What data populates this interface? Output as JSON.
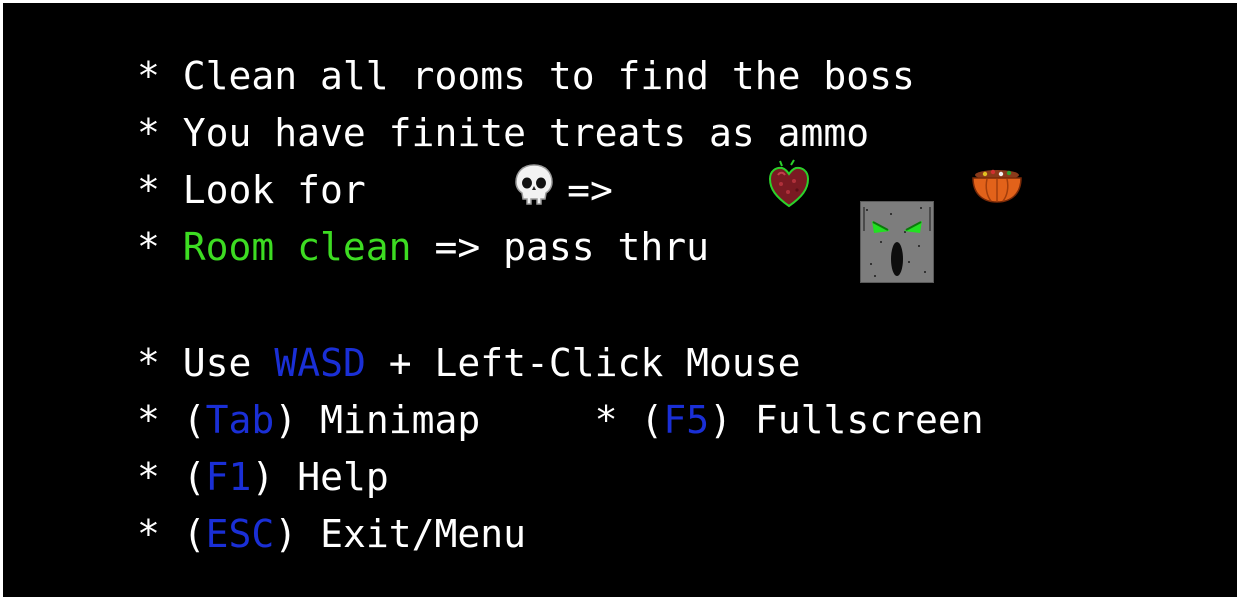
{
  "help": {
    "bullet": "*",
    "line1": "Clean all rooms to find the boss",
    "line2": "You have finite treats as ammo",
    "line3_prefix": "Look for",
    "line3_arrow": "=>",
    "line4_green": "Room clean",
    "line4_rest": "=> pass thru",
    "line5_use": "Use",
    "line5_keys": "WASD",
    "line5_rest": "+ Left-Click Mouse",
    "line6_open": "(",
    "line6_key": "Tab",
    "line6_close": ")",
    "line6_rest": "Minimap",
    "line6b_key": "F5",
    "line6b_rest": "Fullscreen",
    "line7_key": "F1",
    "line7_rest": "Help",
    "line8_key": "ESC",
    "line8_rest": "Exit/Menu"
  },
  "icons": {
    "skull": "skull-icon",
    "heart": "heart-icon",
    "pumpkin": "pumpkin-basket-icon",
    "door": "door-face-icon"
  },
  "colors": {
    "background": "#000000",
    "text": "#ffffff",
    "key_highlight": "#1a2fd6",
    "room_clean": "#3ddc22"
  }
}
